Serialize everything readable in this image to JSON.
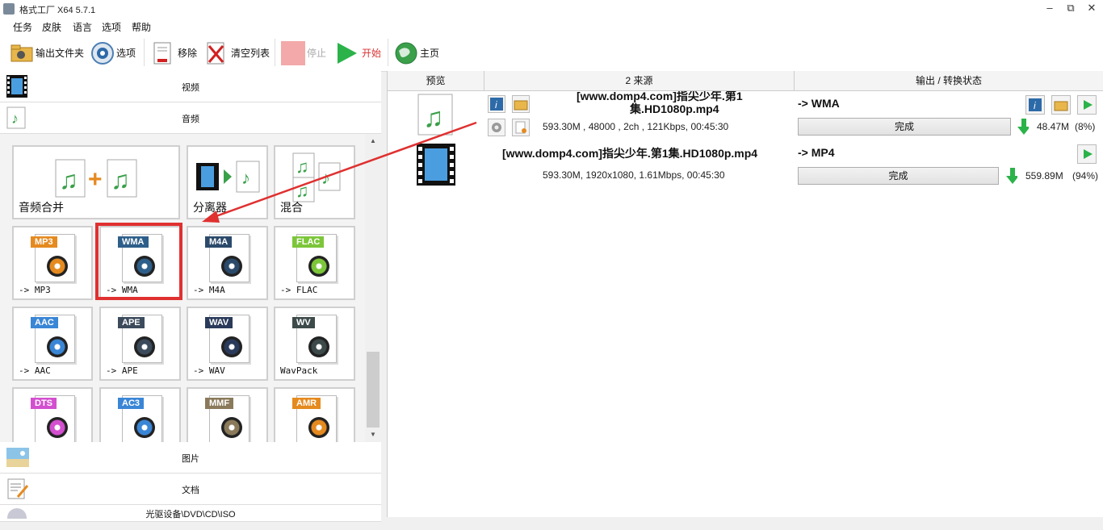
{
  "window": {
    "title": "格式工厂 X64 5.7.1",
    "minimize": "–",
    "restore": "⧉",
    "close": "✕"
  },
  "menu": [
    "任务",
    "皮肤",
    "语言",
    "选项",
    "帮助"
  ],
  "toolbar": {
    "output_folder": "输出文件夹",
    "options": "选项",
    "remove": "移除",
    "clear_list": "清空列表",
    "stop": "停止",
    "start": "开始",
    "home": "主页"
  },
  "categories": {
    "video": "视频",
    "audio": "音频",
    "picture": "图片",
    "document": "文档",
    "rom": "光驱设备\\DVD\\CD\\ISO"
  },
  "tiles": {
    "merge": "音频合并",
    "splitter": "分离器",
    "mix": "混合",
    "formats": [
      {
        "badge": "MP3",
        "label": "-> MP3",
        "color": "#e58a1f"
      },
      {
        "badge": "WMA",
        "label": "-> WMA",
        "color": "#2e5f8a"
      },
      {
        "badge": "M4A",
        "label": "-> M4A",
        "color": "#2b4a6b"
      },
      {
        "badge": "FLAC",
        "label": "-> FLAC",
        "color": "#7cc63a"
      },
      {
        "badge": "AAC",
        "label": "-> AAC",
        "color": "#3a86d6"
      },
      {
        "badge": "APE",
        "label": "-> APE",
        "color": "#3b4b5c"
      },
      {
        "badge": "WAV",
        "label": "-> WAV",
        "color": "#2a3a5a"
      },
      {
        "badge": "WV",
        "label": "WavPack",
        "color": "#3d4a4a"
      },
      {
        "badge": "DTS",
        "label": "",
        "color": "#d34fcf"
      },
      {
        "badge": "AC3",
        "label": "",
        "color": "#3a86d6"
      },
      {
        "badge": "MMF",
        "label": "",
        "color": "#8a7a5a"
      },
      {
        "badge": "AMR",
        "label": "",
        "color": "#e58a1f"
      }
    ]
  },
  "table": {
    "headers": [
      "预览",
      "2 来源",
      "输出 / 转换状态"
    ],
    "rows": [
      {
        "source_name_line1": "[www.domp4.com]指尖少年.第1",
        "source_name_line2": "集.HD1080p.mp4",
        "meta": "593.30M , 48000 , 2ch , 121Kbps, 00:45:30",
        "output": "-> WMA",
        "status": "完成",
        "size": "48.47M",
        "percent": "(8%)"
      },
      {
        "source_name": "[www.domp4.com]指尖少年.第1集.HD1080p.mp4",
        "meta": "593.30M, 1920x1080, 1.61Mbps, 00:45:30",
        "output": "-> MP4",
        "status": "完成",
        "size": "559.89M",
        "percent": "(94%)"
      }
    ]
  },
  "colors": {
    "highlight": "#e03030",
    "arrow": "#e03030",
    "play_green": "#2bb34a"
  }
}
